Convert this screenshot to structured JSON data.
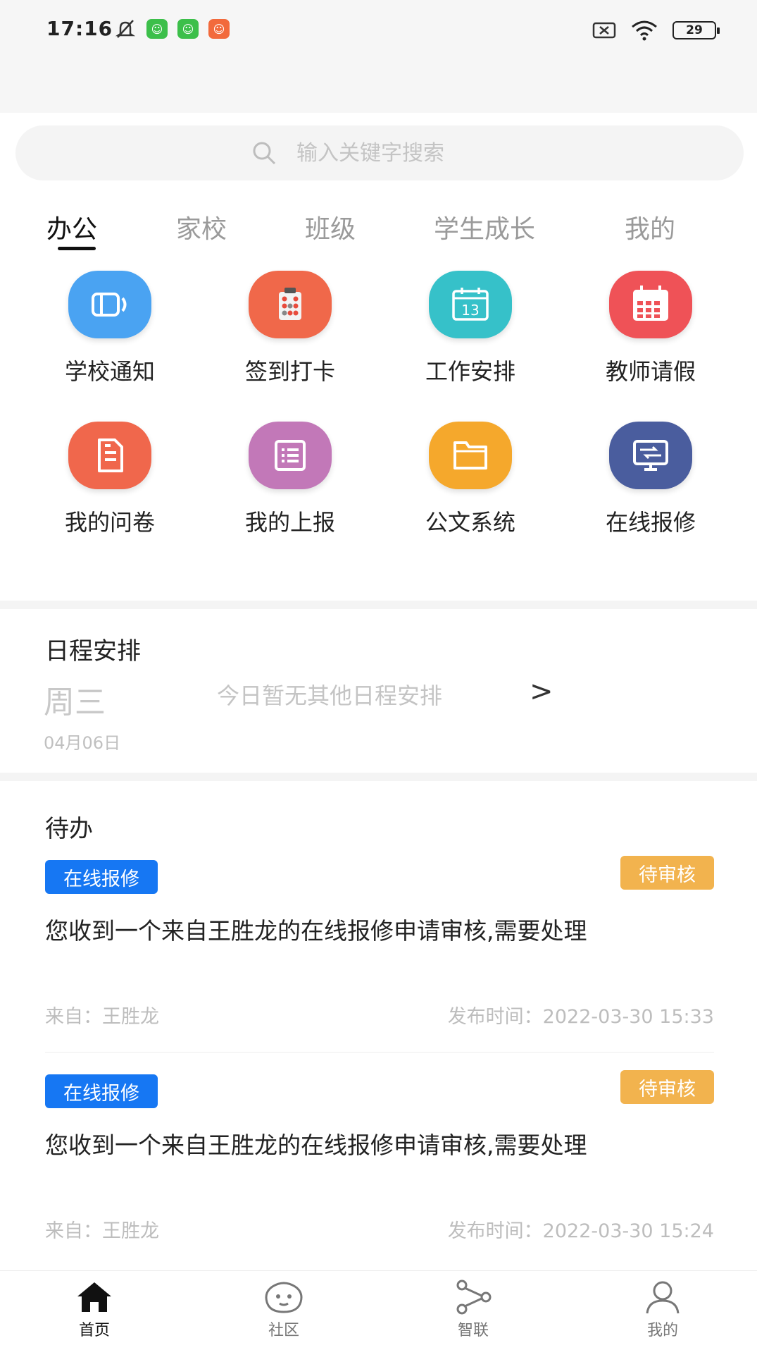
{
  "status_bar": {
    "time": "17:16",
    "battery": "29"
  },
  "search": {
    "placeholder": "输入关键字搜索"
  },
  "tabs": [
    {
      "label": "办公",
      "active": true
    },
    {
      "label": "家校",
      "active": false
    },
    {
      "label": "班级",
      "active": false
    },
    {
      "label": "学生成长",
      "active": false
    },
    {
      "label": "我的",
      "active": false
    }
  ],
  "apps": [
    {
      "label": "学校通知",
      "icon": "speaker-icon",
      "color": "#4aa3f2"
    },
    {
      "label": "签到打卡",
      "icon": "checkin-icon",
      "color": "#f0684a"
    },
    {
      "label": "工作安排",
      "icon": "calendar-13-icon",
      "color": "#36c1c9"
    },
    {
      "label": "教师请假",
      "icon": "calendar-grid-icon",
      "color": "#ef5257"
    },
    {
      "label": "我的问卷",
      "icon": "document-icon",
      "color": "#f0674c"
    },
    {
      "label": "我的上报",
      "icon": "list-icon",
      "color": "#c278b8"
    },
    {
      "label": "公文系统",
      "icon": "folder-icon",
      "color": "#f5a82c"
    },
    {
      "label": "在线报修",
      "icon": "screen-icon",
      "color": "#4a5d9e"
    }
  ],
  "schedule": {
    "title": "日程安排",
    "weekday": "周三",
    "date": "04月06日",
    "message": "今日暂无其他日程安排",
    "arrow": ">"
  },
  "todo": {
    "title": "待办",
    "items": [
      {
        "tag": "在线报修",
        "status": "待审核",
        "text": "您收到一个来自王胜龙的在线报修申请审核,需要处理",
        "from": "来自：王胜龙",
        "time": "发布时间：2022-03-30 15:33"
      },
      {
        "tag": "在线报修",
        "status": "待审核",
        "text": "您收到一个来自王胜龙的在线报修申请审核,需要处理",
        "from": "来自：王胜龙",
        "time": "发布时间：2022-03-30 15:24"
      }
    ]
  },
  "bottom_nav": [
    {
      "label": "首页",
      "icon": "home-icon",
      "active": true
    },
    {
      "label": "社区",
      "icon": "community-icon",
      "active": false
    },
    {
      "label": "智联",
      "icon": "connect-icon",
      "active": false
    },
    {
      "label": "我的",
      "icon": "user-icon",
      "active": false
    }
  ],
  "colors": {
    "accent_blue": "#1677f3",
    "pending_orange": "#f2b34e"
  }
}
